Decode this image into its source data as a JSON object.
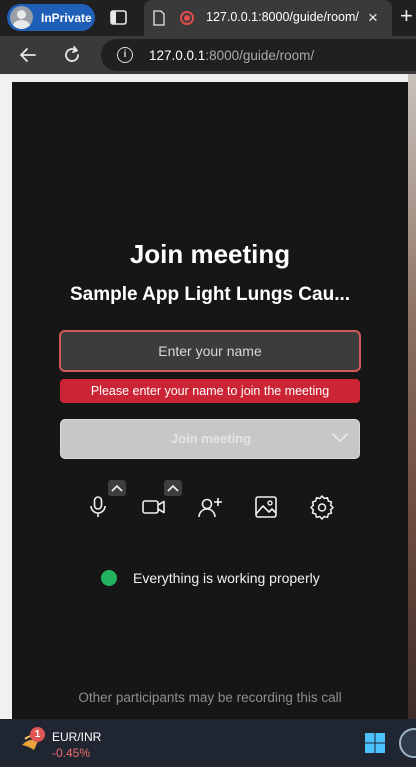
{
  "browser": {
    "profile_label": "InPrivate",
    "tab_title": "127.0.0.1:8000/guide/room/",
    "tab_close": "×",
    "new_tab": "+",
    "url_host": "127.0.0.1",
    "url_rest": ":8000/guide/room/"
  },
  "meeting": {
    "heading": "Join meeting",
    "room_name": "Sample App Light Lungs Cau...",
    "name_placeholder": "Enter your name",
    "name_value": "",
    "error": "Please enter your name to join the meeting",
    "join_button": "Join meeting",
    "controls": [
      "microphone-icon",
      "camera-icon",
      "invite-people-icon",
      "background-icon",
      "settings-icon"
    ],
    "status_text": "Everything is working properly",
    "status_color": "#22b35e",
    "notice": "Other participants may be recording this call"
  },
  "taskbar": {
    "ticker_badge": "1",
    "ticker_pair": "EUR/INR",
    "ticker_change": "-0.45%"
  },
  "colors": {
    "error_bg": "#cb2434",
    "input_border": "#d45a5a",
    "panel_bg": "#161616",
    "inprivate_pill": "#1f5fb8"
  }
}
